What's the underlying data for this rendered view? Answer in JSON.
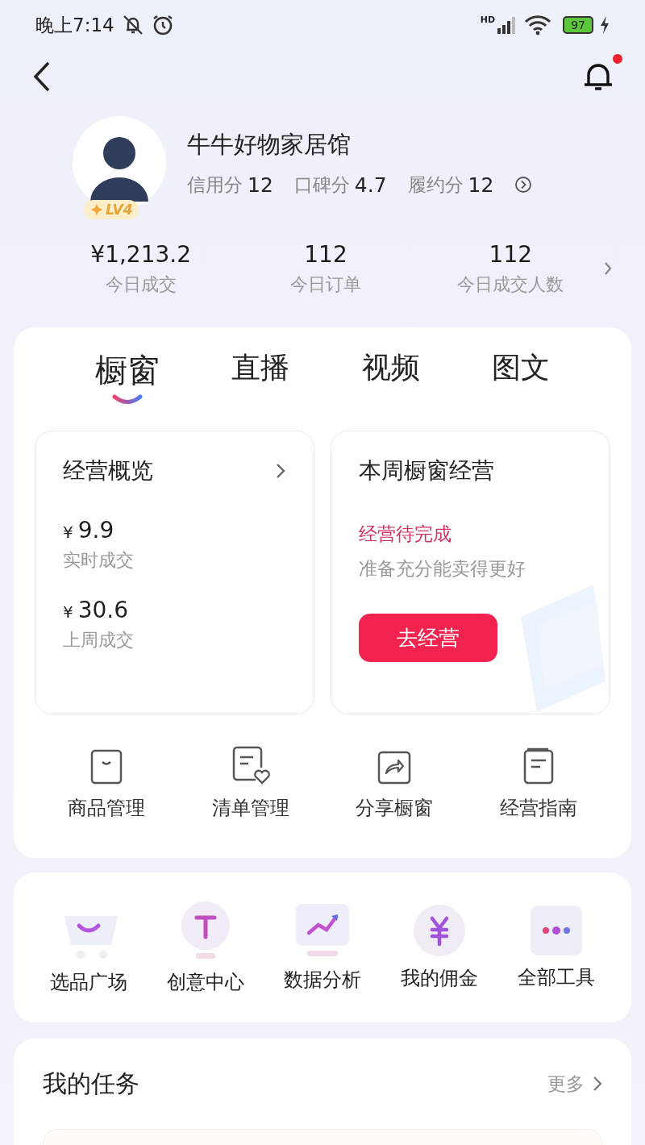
{
  "status_bar": {
    "time": "晚上7:14",
    "network": "HD",
    "battery": "97"
  },
  "header": {
    "has_notification": true
  },
  "profile": {
    "name": "牛牛好物家居馆",
    "level": "LV4",
    "scores": [
      {
        "label": "信用分",
        "value": "12"
      },
      {
        "label": "口碑分",
        "value": "4.7"
      },
      {
        "label": "履约分",
        "value": "12"
      }
    ]
  },
  "stats": [
    {
      "value": "¥1,213.2",
      "label": "今日成交"
    },
    {
      "value": "112",
      "label": "今日订单"
    },
    {
      "value": "112",
      "label": "今日成交人数"
    }
  ],
  "tabs": [
    {
      "label": "橱窗",
      "selected": true
    },
    {
      "label": "直播",
      "selected": false
    },
    {
      "label": "视频",
      "selected": false
    },
    {
      "label": "图文",
      "selected": false
    }
  ],
  "overview": {
    "title": "经营概览",
    "items": [
      {
        "currency": "¥",
        "amount": "9.9",
        "label": "实时成交"
      },
      {
        "currency": "¥",
        "amount": "30.6",
        "label": "上周成交"
      }
    ]
  },
  "weekly": {
    "title": "本周橱窗经营",
    "status": "经营待完成",
    "hint": "准备充分能卖得更好",
    "button": "去经营"
  },
  "quick_actions": [
    {
      "kind": "bag",
      "label": "商品管理"
    },
    {
      "kind": "list",
      "label": "清单管理"
    },
    {
      "kind": "share",
      "label": "分享橱窗"
    },
    {
      "kind": "guide",
      "label": "经营指南"
    }
  ],
  "tools": [
    {
      "kind": "cart",
      "label": "选品广场"
    },
    {
      "kind": "bulb",
      "label": "创意中心"
    },
    {
      "kind": "chart",
      "label": "数据分析"
    },
    {
      "kind": "yen",
      "label": "我的佣金"
    },
    {
      "kind": "more",
      "label": "全部工具"
    }
  ],
  "tasks": {
    "title": "我的任务",
    "more": "更多"
  }
}
